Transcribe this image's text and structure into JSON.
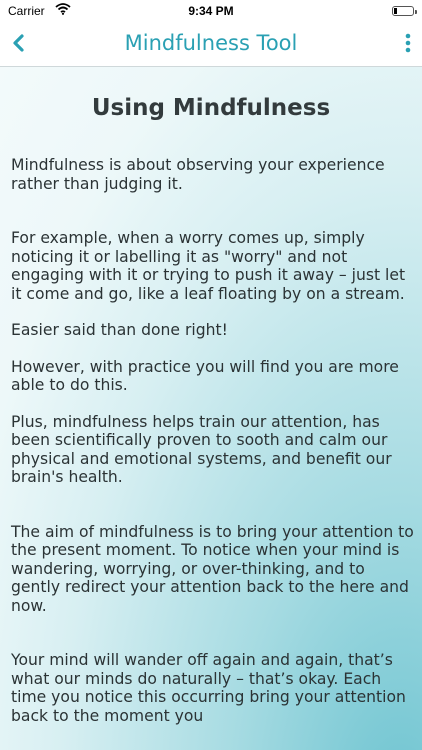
{
  "status_bar": {
    "carrier": "Carrier",
    "time": "9:34 PM"
  },
  "nav": {
    "title": "Mindfulness Tool",
    "accent_color": "#2aa0b3",
    "back_icon": "chevron-left-icon",
    "menu_icon": "vertical-dots-icon"
  },
  "content": {
    "heading": "Using Mindfulness",
    "paragraphs": [
      "Mindfulness is about observing your experience rather than judging it.",
      "For example, when a worry comes up, simply noticing it or labelling it as \"worry\" and not engaging with it or trying to push it away – just let it come and go, like a leaf floating by on a stream.",
      "Easier said than done right!",
      "However, with practice you will find you are more able to do this.",
      "Plus, mindfulness helps train our attention, has been scientifically proven to sooth and calm our physical and emotional systems, and benefit our brain's health.",
      "The aim of mindfulness is to bring your attention to the present moment. To notice when your mind is wandering, worrying, or over-thinking, and to gently redirect your attention back to the here and now.",
      "Your mind will wander off again and again, that’s what our minds do naturally – that’s okay. Each time you notice this occurring bring your attention back to the moment you"
    ]
  }
}
